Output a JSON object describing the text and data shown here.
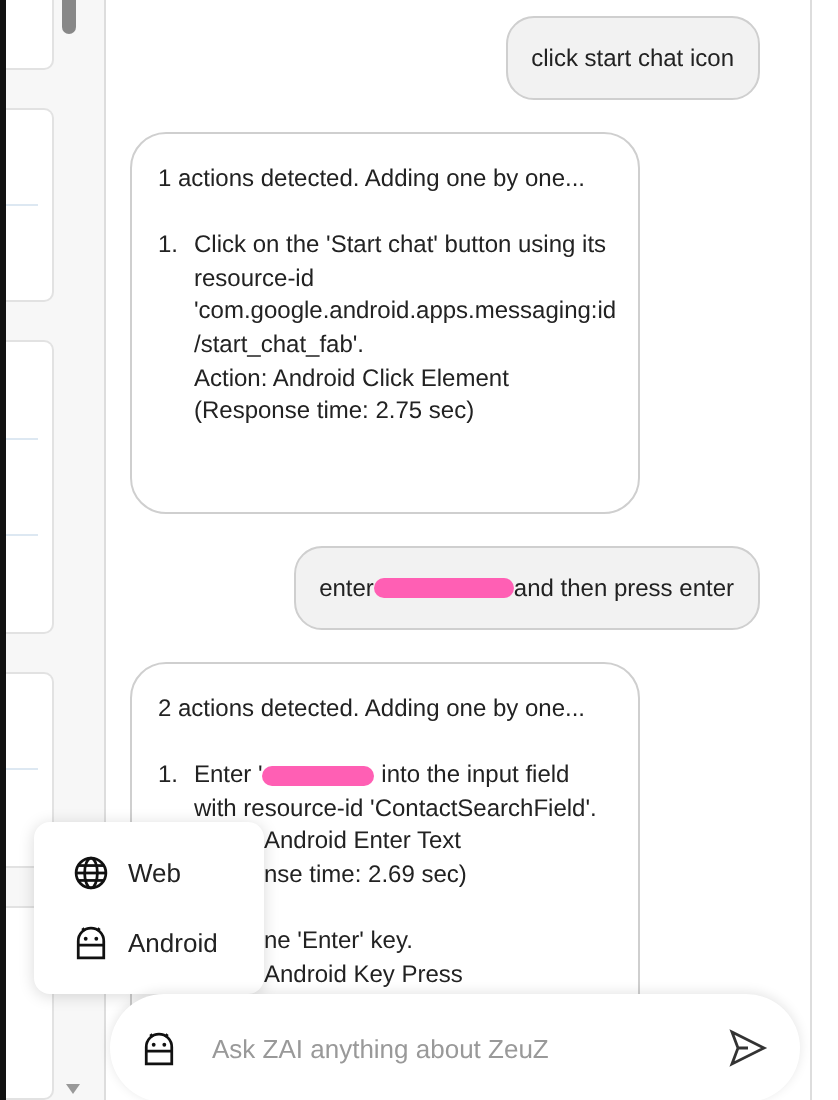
{
  "messages": [
    {
      "kind": "user",
      "parts": [
        {
          "kind": "text",
          "text": "click start chat icon"
        }
      ]
    },
    {
      "kind": "bot",
      "header": "1 actions detected. Adding one by one...",
      "steps": [
        {
          "number": "1.",
          "parts": [
            {
              "kind": "text",
              "text": "Click on the 'Start chat' button using its\nresource-id\n'com.google.android.apps.messaging:id\n/start_chat_fab'."
            }
          ],
          "lines": [
            {
              "text": "Action: Android Click Element",
              "covered": false
            },
            {
              "text": "(Response time: 2.75 sec)",
              "covered": false
            }
          ]
        }
      ]
    },
    {
      "kind": "user",
      "parts": [
        {
          "kind": "text",
          "text": "enter "
        },
        {
          "kind": "redaction"
        },
        {
          "kind": "text",
          "text": " and then press enter"
        }
      ]
    },
    {
      "kind": "bot",
      "header": "2 actions detected. Adding one by one...",
      "steps": [
        {
          "number": "1.",
          "parts": [
            {
              "kind": "text",
              "text": "Enter '"
            },
            {
              "kind": "redaction"
            },
            {
              "kind": "text",
              "text": " into the input field\nwith resource-id 'ContactSearchField'."
            }
          ],
          "lines": [
            {
              "text": "Android Enter Text",
              "covered": true
            },
            {
              "text": "nse time: 2.69 sec)",
              "covered": true
            }
          ]
        },
        {
          "lines": [
            {
              "text": "ne 'Enter' key.",
              "covered": true
            },
            {
              "text": "Android Key Press",
              "covered": true
            }
          ]
        }
      ]
    }
  ],
  "menu": {
    "items": [
      {
        "label": "Web"
      },
      {
        "label": "Android"
      }
    ]
  },
  "input": {
    "placeholder": "Ask ZAI anything about ZeuZ"
  }
}
